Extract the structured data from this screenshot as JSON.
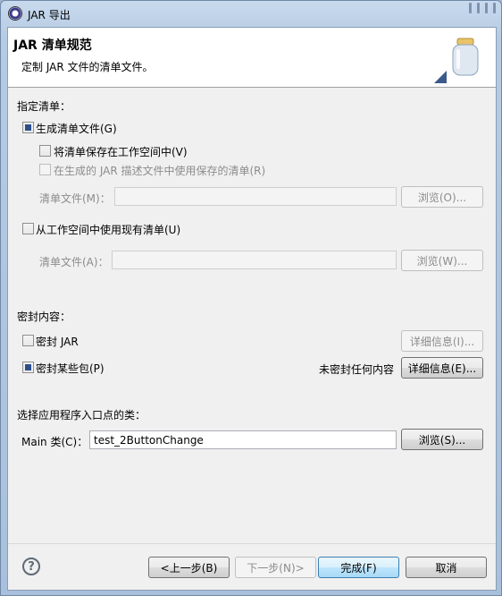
{
  "window": {
    "title": "JAR 导出"
  },
  "banner": {
    "title": "JAR 清单规范",
    "description": "定制 JAR 文件的清单文件。"
  },
  "manifest": {
    "section_label": "指定清单：",
    "generate_label": "生成清单文件(G)",
    "generate_checked": true,
    "save_label": "将清单保存在工作空间中(V)",
    "save_checked": false,
    "reuse_label": "在生成的 JAR 描述文件中使用保存的清单(R)",
    "reuse_checked": false,
    "manifest_file_label_1": "清单文件(M)：",
    "manifest_file_value_1": "",
    "browse_1": "浏览(O)...",
    "use_existing_label": "从工作空间中使用现有清单(U)",
    "use_existing_checked": false,
    "manifest_file_label_2": "清单文件(A)：",
    "manifest_file_value_2": "",
    "browse_2": "浏览(W)..."
  },
  "seal": {
    "section_label": "密封内容：",
    "seal_jar_label": "密封 JAR",
    "seal_jar_checked": false,
    "details_1": "详细信息(I)...",
    "seal_packages_label": "密封某些包(P)",
    "seal_packages_checked": true,
    "status": "未密封任何内容",
    "details_2": "详细信息(E)..."
  },
  "entry": {
    "section_label": "选择应用程序入口点的类：",
    "main_label": "Main 类(C)：",
    "main_value": "test_2ButtonChange",
    "browse": "浏览(S)..."
  },
  "footer": {
    "help_icon": "help-icon",
    "back": "<上一步(B)",
    "next": "下一步(N)>",
    "finish": "完成(F)",
    "cancel": "取消"
  }
}
